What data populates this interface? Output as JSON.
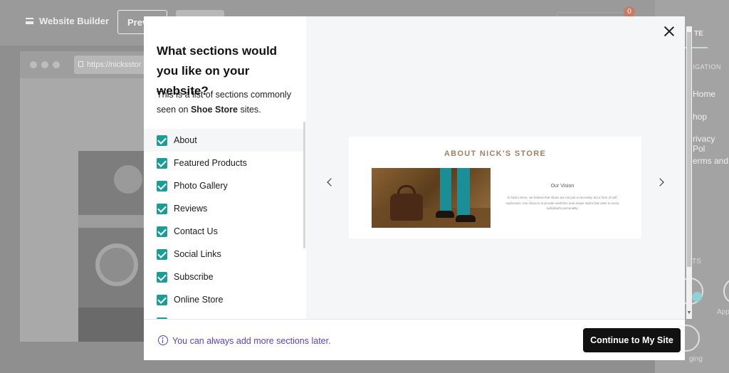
{
  "background": {
    "app_title": "Website Builder",
    "preview_button": "Previ",
    "browser_url": "https://nicksstor",
    "right_panel": {
      "tab": "TE",
      "heading": "IGATION",
      "items": [
        "Home",
        "hop",
        "rivacy Pol",
        "erms and"
      ],
      "section_label": "TS",
      "small_label_1": "App",
      "small_label_2": "ging"
    }
  },
  "modal": {
    "title": "What sections would you like on your website?",
    "description_prefix": "This is a list of sections commonly seen on ",
    "description_bold": "Shoe Store",
    "description_suffix": " sites.",
    "sections": [
      {
        "label": "About",
        "checked": true
      },
      {
        "label": "Featured Products",
        "checked": true
      },
      {
        "label": "Photo Gallery",
        "checked": true
      },
      {
        "label": "Reviews",
        "checked": true
      },
      {
        "label": "Contact Us",
        "checked": true
      },
      {
        "label": "Social Links",
        "checked": true
      },
      {
        "label": "Subscribe",
        "checked": true
      },
      {
        "label": "Online Store",
        "checked": true
      }
    ],
    "preview": {
      "heading": "ABOUT NICK'S STORE",
      "subheading": "Our Vision",
      "body": "At Nick's Store, we believe that shoes are not just a necessity, but a form of self-expression. Our vision is to provide aesthetic and unique styles that cater to every individual's personality."
    },
    "footer_note": "You can always add more sections later.",
    "continue_button": "Continue to My Site"
  },
  "colors": {
    "accent": "#1a9d99",
    "link": "#5b3fd1",
    "primary_button": "#111111",
    "heading_brown": "#a07f62"
  }
}
